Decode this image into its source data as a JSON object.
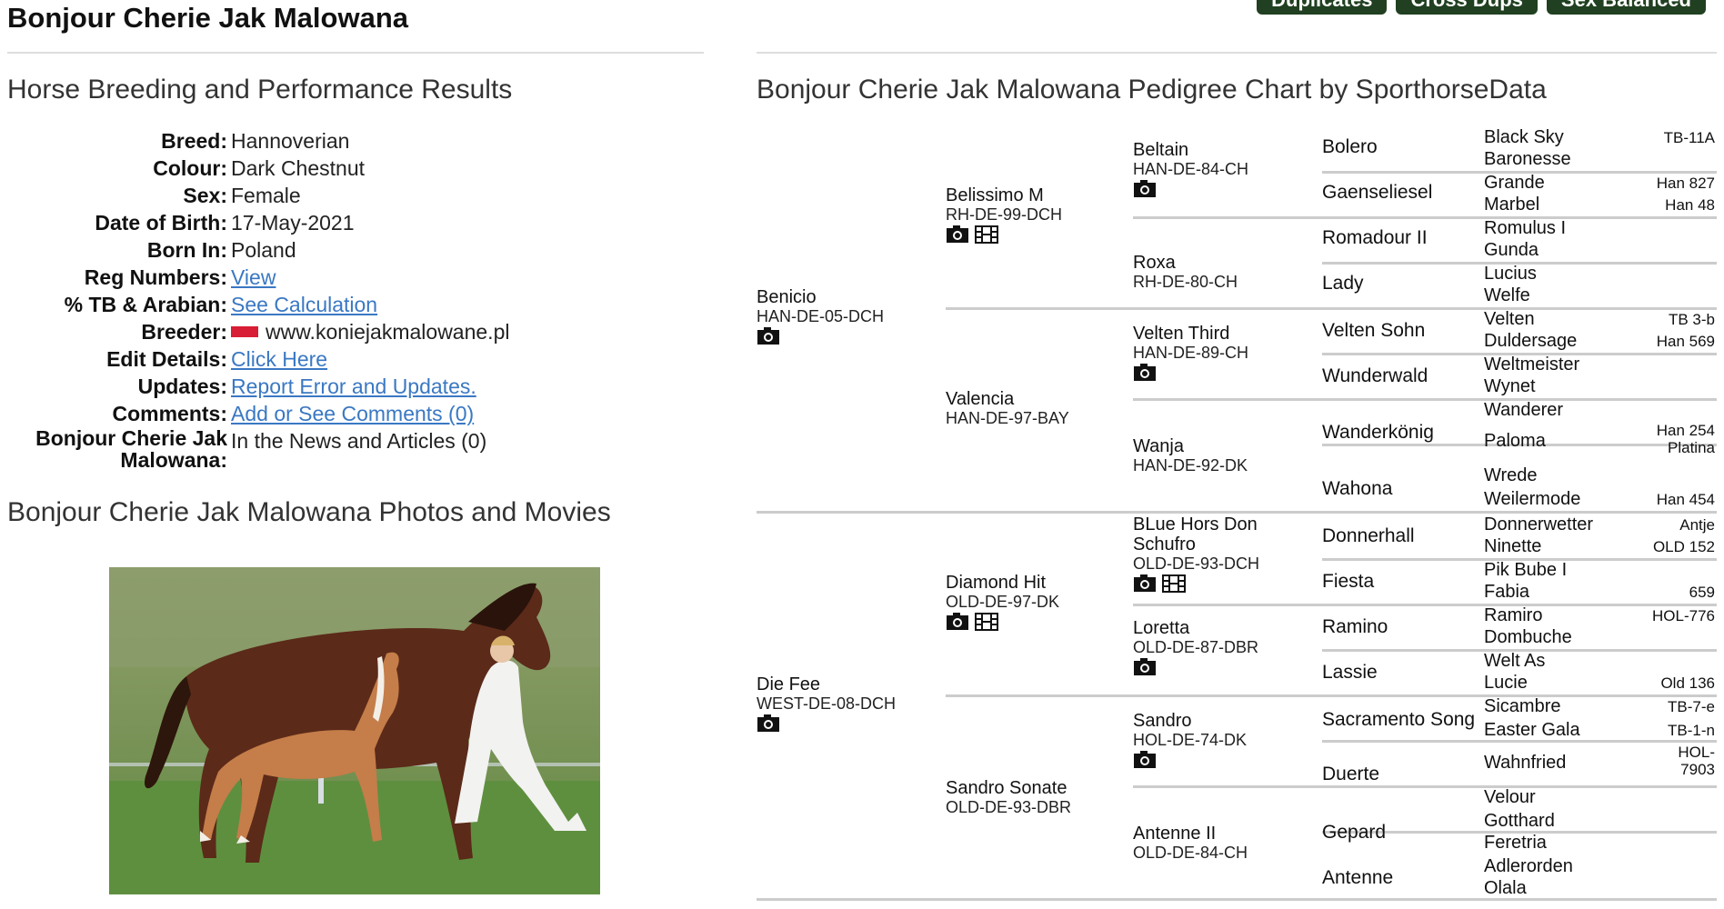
{
  "page_title": "Bonjour Cherie Jak Malowana",
  "top_buttons": [
    "Duplicates",
    "Cross Dups",
    "Sex Balanced"
  ],
  "left": {
    "heading_results": "Horse Breeding and Performance Results",
    "info": [
      {
        "label": "Breed:",
        "value": "Hannoverian",
        "link": false
      },
      {
        "label": "Colour:",
        "value": "Dark Chestnut",
        "link": false
      },
      {
        "label": "Sex:",
        "value": "Female",
        "link": false
      },
      {
        "label": "Date of Birth:",
        "value": "17-May-2021",
        "link": false
      },
      {
        "label": "Born In:",
        "value": "Poland",
        "link": false
      },
      {
        "label": "Reg Numbers:",
        "value": "View",
        "link": true
      },
      {
        "label": "% TB & Arabian:",
        "value": "See Calculation",
        "link": true
      },
      {
        "label": "Breeder:",
        "value": "www.koniejakmalowane.pl",
        "link": false,
        "flag": true
      },
      {
        "label": "Edit Details:",
        "value": "Click Here",
        "link": true
      },
      {
        "label": "Updates:",
        "value": "Report Error and Updates.",
        "link": true
      },
      {
        "label": "Comments:",
        "value": "Add or See Comments (0)",
        "link": true
      },
      {
        "label": "Bonjour Cherie Jak Malowana:",
        "value": "In the News and Articles (0)",
        "link": false
      }
    ],
    "heading_photos": "Bonjour Cherie Jak Malowana Photos and Movies"
  },
  "pedigree": {
    "heading": "Bonjour Cherie Jak Malowana Pedigree Chart by SporthorseData",
    "sire": {
      "name": "Benicio",
      "reg": "HAN-DE-05-DCH"
    },
    "dam": {
      "name": "Die Fee",
      "reg": "WEST-DE-08-DCH"
    },
    "g2": [
      {
        "name": "Belissimo M",
        "reg": "RH-DE-99-DCH"
      },
      {
        "name": "Valencia",
        "reg": "HAN-DE-97-BAY"
      },
      {
        "name": "Diamond Hit",
        "reg": "OLD-DE-97-DK"
      },
      {
        "name": "Sandro Sonate",
        "reg": "OLD-DE-93-DBR"
      }
    ],
    "g3": [
      {
        "name": "Beltain",
        "reg": "HAN-DE-84-CH"
      },
      {
        "name": "Roxa",
        "reg": "RH-DE-80-CH"
      },
      {
        "name": "Velten Third",
        "reg": "HAN-DE-89-CH"
      },
      {
        "name": "Wanja",
        "reg": "HAN-DE-92-DK"
      },
      {
        "name": "BLue Hors Don Schufro",
        "reg": "OLD-DE-93-DCH"
      },
      {
        "name": "Loretta",
        "reg": "OLD-DE-87-DBR"
      },
      {
        "name": "Sandro",
        "reg": "HOL-DE-74-DK"
      },
      {
        "name": "Antenne II",
        "reg": "OLD-DE-84-CH"
      }
    ],
    "g4": [
      "Bolero",
      "Gaenseliesel",
      "Romadour II",
      "Lady",
      "Velten Sohn",
      "Wunderwald",
      "Wanderkönig",
      "Wahona",
      "Donnerhall",
      "Fiesta",
      "Ramino",
      "Lassie",
      "Sacramento Song",
      "Duerte",
      "Gepard",
      "Antenne"
    ],
    "g5": [
      {
        "name": "Black Sky",
        "reg": "TB-11A"
      },
      {
        "name": "Baronesse",
        "reg": ""
      },
      {
        "name": "Grande",
        "reg": "Han 827"
      },
      {
        "name": "Marbel",
        "reg": "Han 48"
      },
      {
        "name": "Romulus I",
        "reg": ""
      },
      {
        "name": "Gunda",
        "reg": ""
      },
      {
        "name": "Lucius",
        "reg": ""
      },
      {
        "name": "Welfe",
        "reg": ""
      },
      {
        "name": "Velten",
        "reg": "TB 3-b"
      },
      {
        "name": "Duldersage",
        "reg": "Han 569"
      },
      {
        "name": "Weltmeister",
        "reg": ""
      },
      {
        "name": "Wynet",
        "reg": ""
      },
      {
        "name": "Wanderer",
        "reg": ""
      },
      {
        "name": "Paloma",
        "reg": "Han 254 Platina"
      },
      {
        "name": "Wrede",
        "reg": ""
      },
      {
        "name": "Weilermode",
        "reg": "Han 454"
      },
      {
        "name": "Donnerwetter",
        "reg": "Antje"
      },
      {
        "name": "Ninette",
        "reg": "OLD 152"
      },
      {
        "name": "Pik Bube I",
        "reg": ""
      },
      {
        "name": "Fabia",
        "reg": "659"
      },
      {
        "name": "Ramiro",
        "reg": "HOL-776"
      },
      {
        "name": "Dombuche",
        "reg": ""
      },
      {
        "name": "Welt As",
        "reg": ""
      },
      {
        "name": "Lucie",
        "reg": "Old 136"
      },
      {
        "name": "Sicambre",
        "reg": "TB-7-e"
      },
      {
        "name": "Easter Gala",
        "reg": "TB-1-n"
      },
      {
        "name": "Wahnfried",
        "reg": "HOL-7903"
      },
      {
        "name": "Velour",
        "reg": ""
      },
      {
        "name": "Gotthard",
        "reg": ""
      },
      {
        "name": "Feretria",
        "reg": ""
      },
      {
        "name": "Adlerorden",
        "reg": ""
      },
      {
        "name": "Olala",
        "reg": ""
      }
    ]
  }
}
